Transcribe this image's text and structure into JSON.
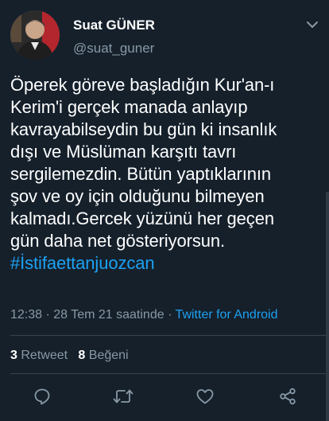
{
  "user": {
    "display_name": "Suat GÜNER",
    "handle": "@suat_guner"
  },
  "tweet": {
    "lines": [
      "Öperek göreve başladığın Kur'an-ı",
      "Kerim'i gerçek manada anlayıp",
      "kavrayabilseydin bu gün ki insanlık",
      "dışı ve Müslüman karşıtı tavrı",
      "sergilemezdin. Bütün yaptıklarının",
      "şov ve oy için olduğunu bilmeyen",
      "kalmadı.Gercek yüzünü her geçen",
      "gün daha net gösteriyorsun."
    ],
    "hashtag": "#İstifaettanjuozcan"
  },
  "meta": {
    "time_date": "12:38 · 28 Tem 21 saatinde · ",
    "source": "Twitter for Android"
  },
  "stats": {
    "retweet_count": "3",
    "retweet_label": "Retweet",
    "like_count": "8",
    "like_label": "Beğeni"
  },
  "icons": {
    "reply": "reply-icon",
    "retweet": "retweet-icon",
    "like": "like-icon",
    "share": "share-icon",
    "menu": "chevron-down-icon"
  },
  "colors": {
    "background": "#15202b",
    "text": "#ffffff",
    "secondary": "#8899a6",
    "accent": "#1da1f2",
    "divider": "#38444d"
  }
}
